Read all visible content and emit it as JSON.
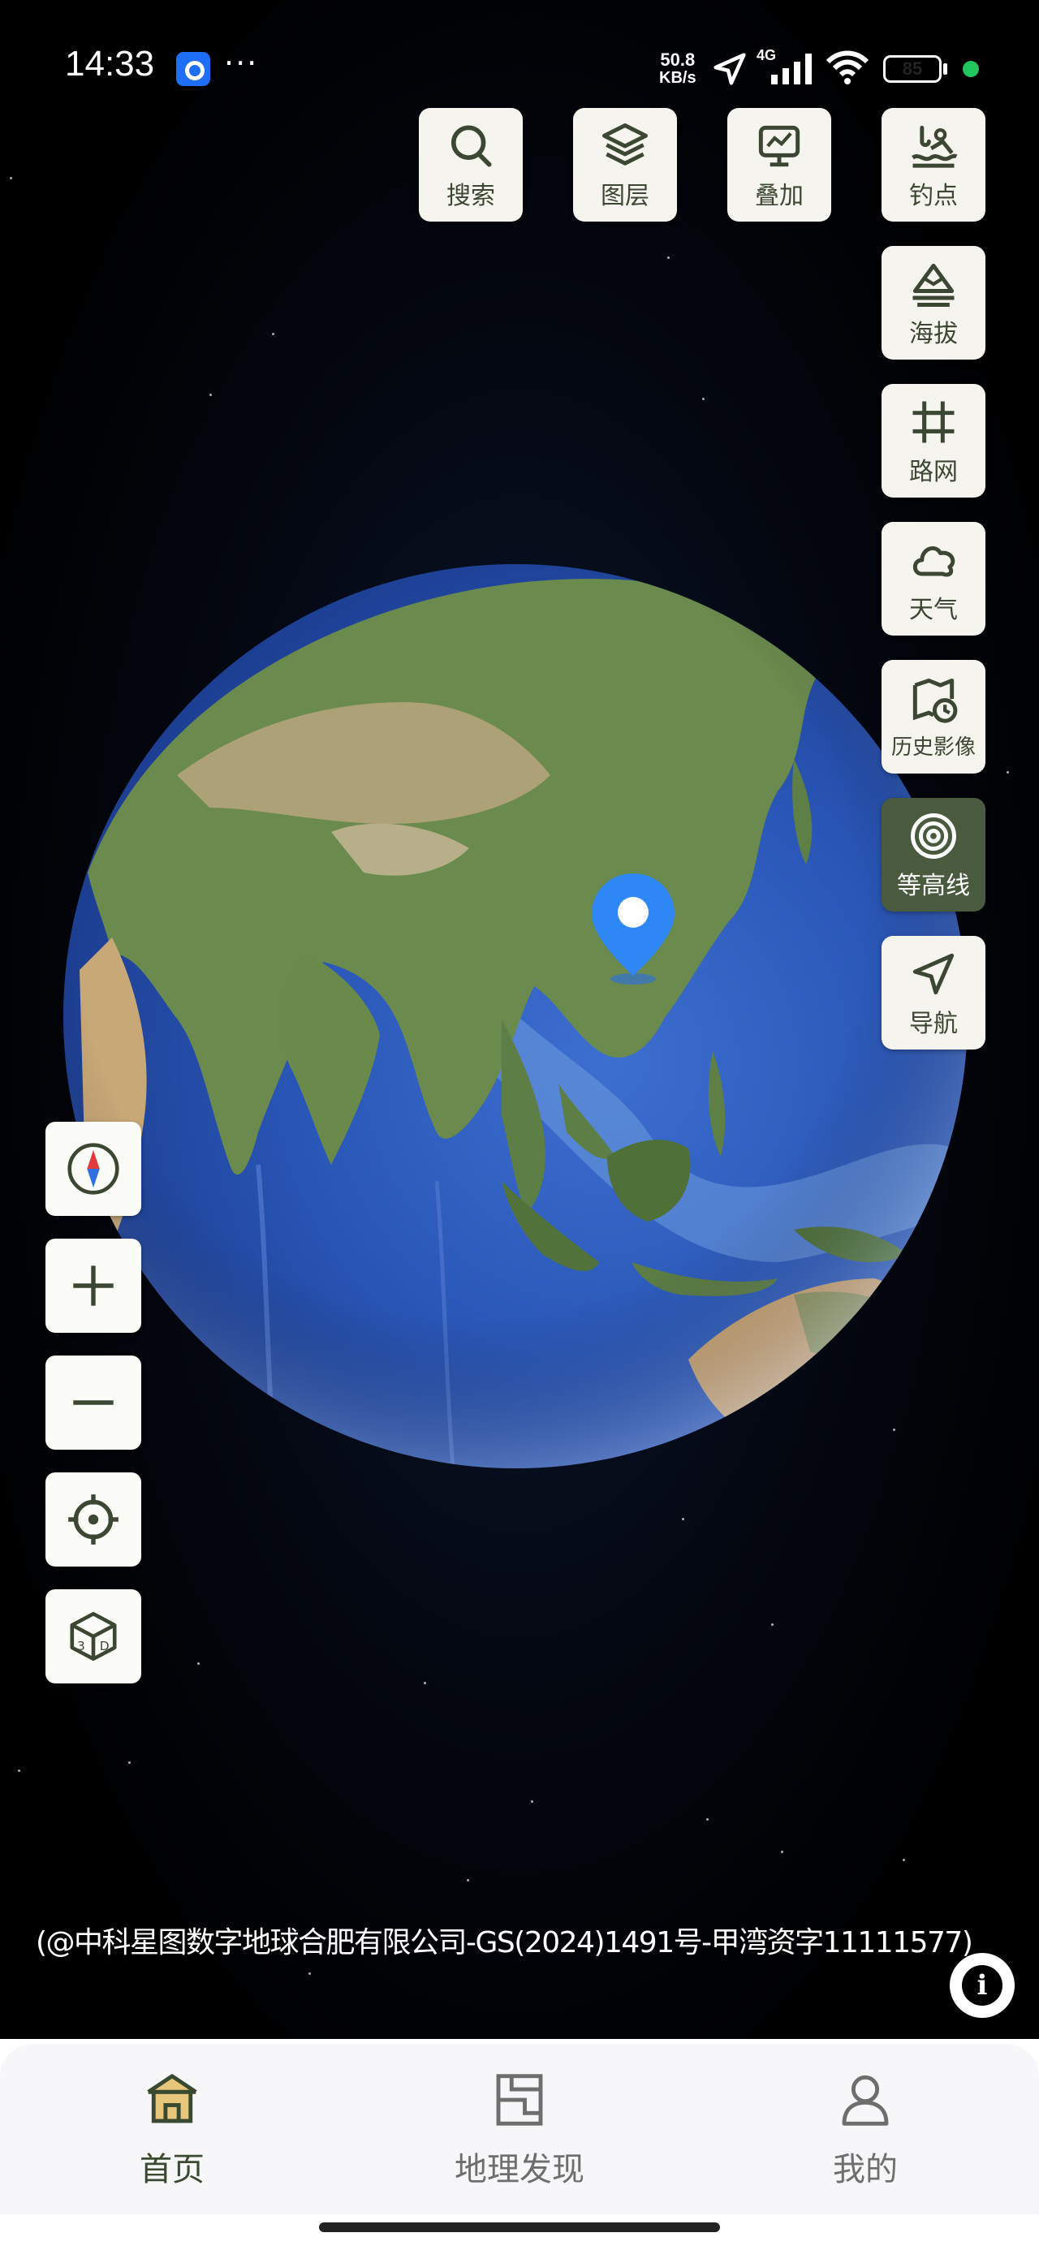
{
  "status_bar": {
    "time": "14:33",
    "more": "···",
    "net_speed_value": "50.8",
    "net_speed_unit": "KB/s",
    "network": "4G",
    "battery": "85"
  },
  "tools": {
    "search": "搜索",
    "layers": "图层",
    "overlay": "叠加",
    "fishing": "钓点",
    "altitude": "海拔",
    "road_network": "路网",
    "weather": "天气",
    "history_imagery": "历史影像",
    "contour": "等高线",
    "navigation": "导航"
  },
  "copyright": "(@中科星图数字地球合肥有限公司-GS(2024)1491号-甲湾资字11111577)",
  "bottom_nav": {
    "home": "首页",
    "discover": "地理发现",
    "mine": "我的",
    "active": "home"
  },
  "colors": {
    "accent": "#4a5a3e",
    "tool_bg": "#f6f4ee",
    "pin": "#2f86f5"
  },
  "icons": [
    "search-icon",
    "layers-icon",
    "overlay-icon",
    "fishing-icon",
    "altitude-icon",
    "road-network-icon",
    "weather-icon",
    "history-imagery-icon",
    "contour-icon",
    "navigation-icon",
    "compass-icon",
    "zoom-in-icon",
    "zoom-out-icon",
    "locate-icon",
    "3d-icon",
    "info-icon",
    "home-icon",
    "discover-icon",
    "mine-icon"
  ]
}
